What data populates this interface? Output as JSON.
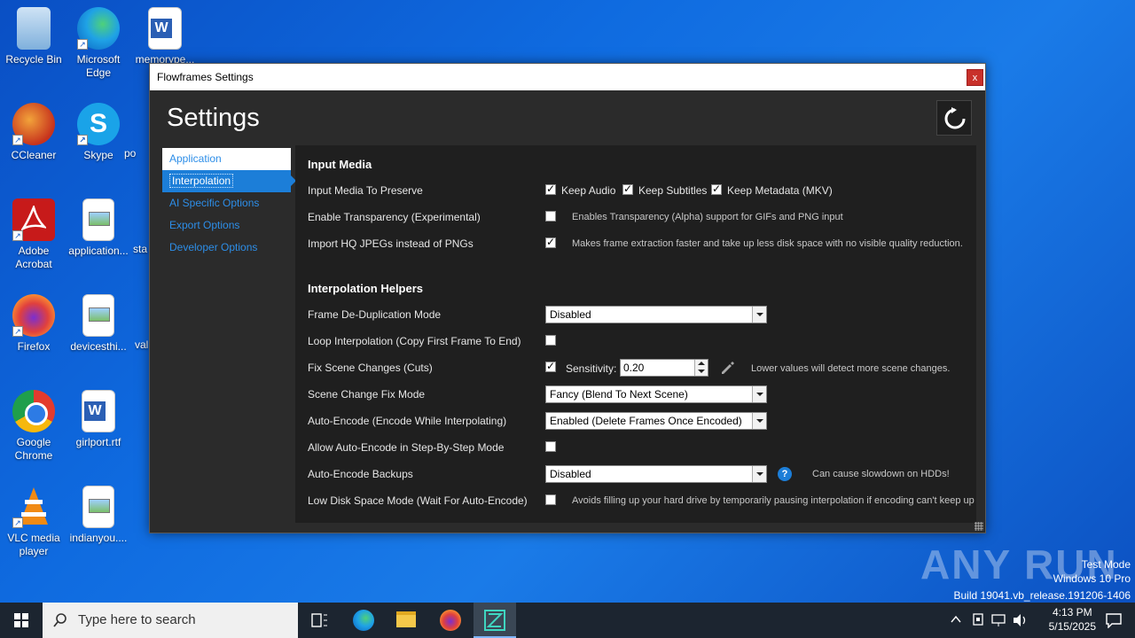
{
  "desktop": {
    "icons": [
      {
        "label": "Recycle Bin",
        "icon": "recycle-bin-icon"
      },
      {
        "label": "Microsoft Edge",
        "icon": "edge-icon"
      },
      {
        "label": "memorype...",
        "icon": "word-document-icon"
      },
      {
        "label": "CCleaner",
        "icon": "ccleaner-icon"
      },
      {
        "label": "Skype",
        "icon": "skype-icon"
      },
      {
        "label": "po",
        "icon": "file-icon"
      },
      {
        "label": "Adobe Acrobat",
        "icon": "acrobat-icon"
      },
      {
        "label": "application...",
        "icon": "image-file-icon"
      },
      {
        "label": "sta",
        "icon": "file-icon"
      },
      {
        "label": "Firefox",
        "icon": "firefox-icon"
      },
      {
        "label": "devicesthi...",
        "icon": "image-file-icon"
      },
      {
        "label": "val",
        "icon": "file-icon"
      },
      {
        "label": "Google Chrome",
        "icon": "chrome-icon"
      },
      {
        "label": "girlport.rtf",
        "icon": "word-document-icon"
      },
      {
        "label": "VLC media player",
        "icon": "vlc-icon"
      },
      {
        "label": "indianyou....",
        "icon": "image-file-icon"
      }
    ]
  },
  "window": {
    "title": "Flowframes Settings",
    "close_label": "x",
    "heading": "Settings"
  },
  "nav": {
    "items": [
      {
        "label": "Application"
      },
      {
        "label": "Interpolation"
      },
      {
        "label": "AI Specific Options"
      },
      {
        "label": "Export Options"
      },
      {
        "label": "Developer Options"
      }
    ],
    "active_index": 1
  },
  "input_media": {
    "title": "Input Media",
    "preserve": {
      "label": "Input Media To Preserve",
      "keep_audio": "Keep Audio",
      "keep_subtitles": "Keep Subtitles",
      "keep_metadata": "Keep Metadata (MKV)"
    },
    "transparency": {
      "label": "Enable Transparency (Experimental)",
      "hint": "Enables Transparency (Alpha) support for GIFs and PNG input",
      "checked": false
    },
    "hq_jpegs": {
      "label": "Import HQ JPEGs instead of PNGs",
      "hint": "Makes frame extraction faster and take up less disk space with no visible quality reduction.",
      "checked": true
    }
  },
  "helpers": {
    "title": "Interpolation Helpers",
    "dedup": {
      "label": "Frame De-Duplication Mode",
      "value": "Disabled"
    },
    "loop": {
      "label": "Loop Interpolation (Copy First Frame To End)",
      "checked": false
    },
    "scene": {
      "label": "Fix Scene Changes (Cuts)",
      "checked": true,
      "sensitivity_label": "Sensitivity:",
      "sensitivity_value": "0.20",
      "hint": "Lower values will detect more scene changes."
    },
    "scene_mode": {
      "label": "Scene Change Fix Mode",
      "value": "Fancy (Blend To Next Scene)"
    },
    "auto_encode": {
      "label": "Auto-Encode (Encode While Interpolating)",
      "value": "Enabled (Delete Frames Once Encoded)"
    },
    "auto_encode_step": {
      "label": "Allow Auto-Encode in Step-By-Step Mode",
      "checked": false
    },
    "backups": {
      "label": "Auto-Encode Backups",
      "value": "Disabled",
      "hint": "Can cause slowdown on HDDs!"
    },
    "low_disk": {
      "label": "Low Disk Space Mode (Wait For Auto-Encode)",
      "hint": "Avoids filling up your hard drive by temporarily pausing interpolation if encoding can't keep up",
      "checked": false
    }
  },
  "watermark": {
    "brand": "ANY RUN",
    "test_mode": "Test Mode",
    "os": "Windows 10 Pro",
    "build": "Build 19041.vb_release.191206-1406"
  },
  "taskbar": {
    "search_placeholder": "Type here to search",
    "time": "4:13 PM",
    "date": "5/15/2025"
  },
  "colors": {
    "accent": "#1c7ed8",
    "panel": "#1f1f1f",
    "window": "#2b2b2b"
  }
}
